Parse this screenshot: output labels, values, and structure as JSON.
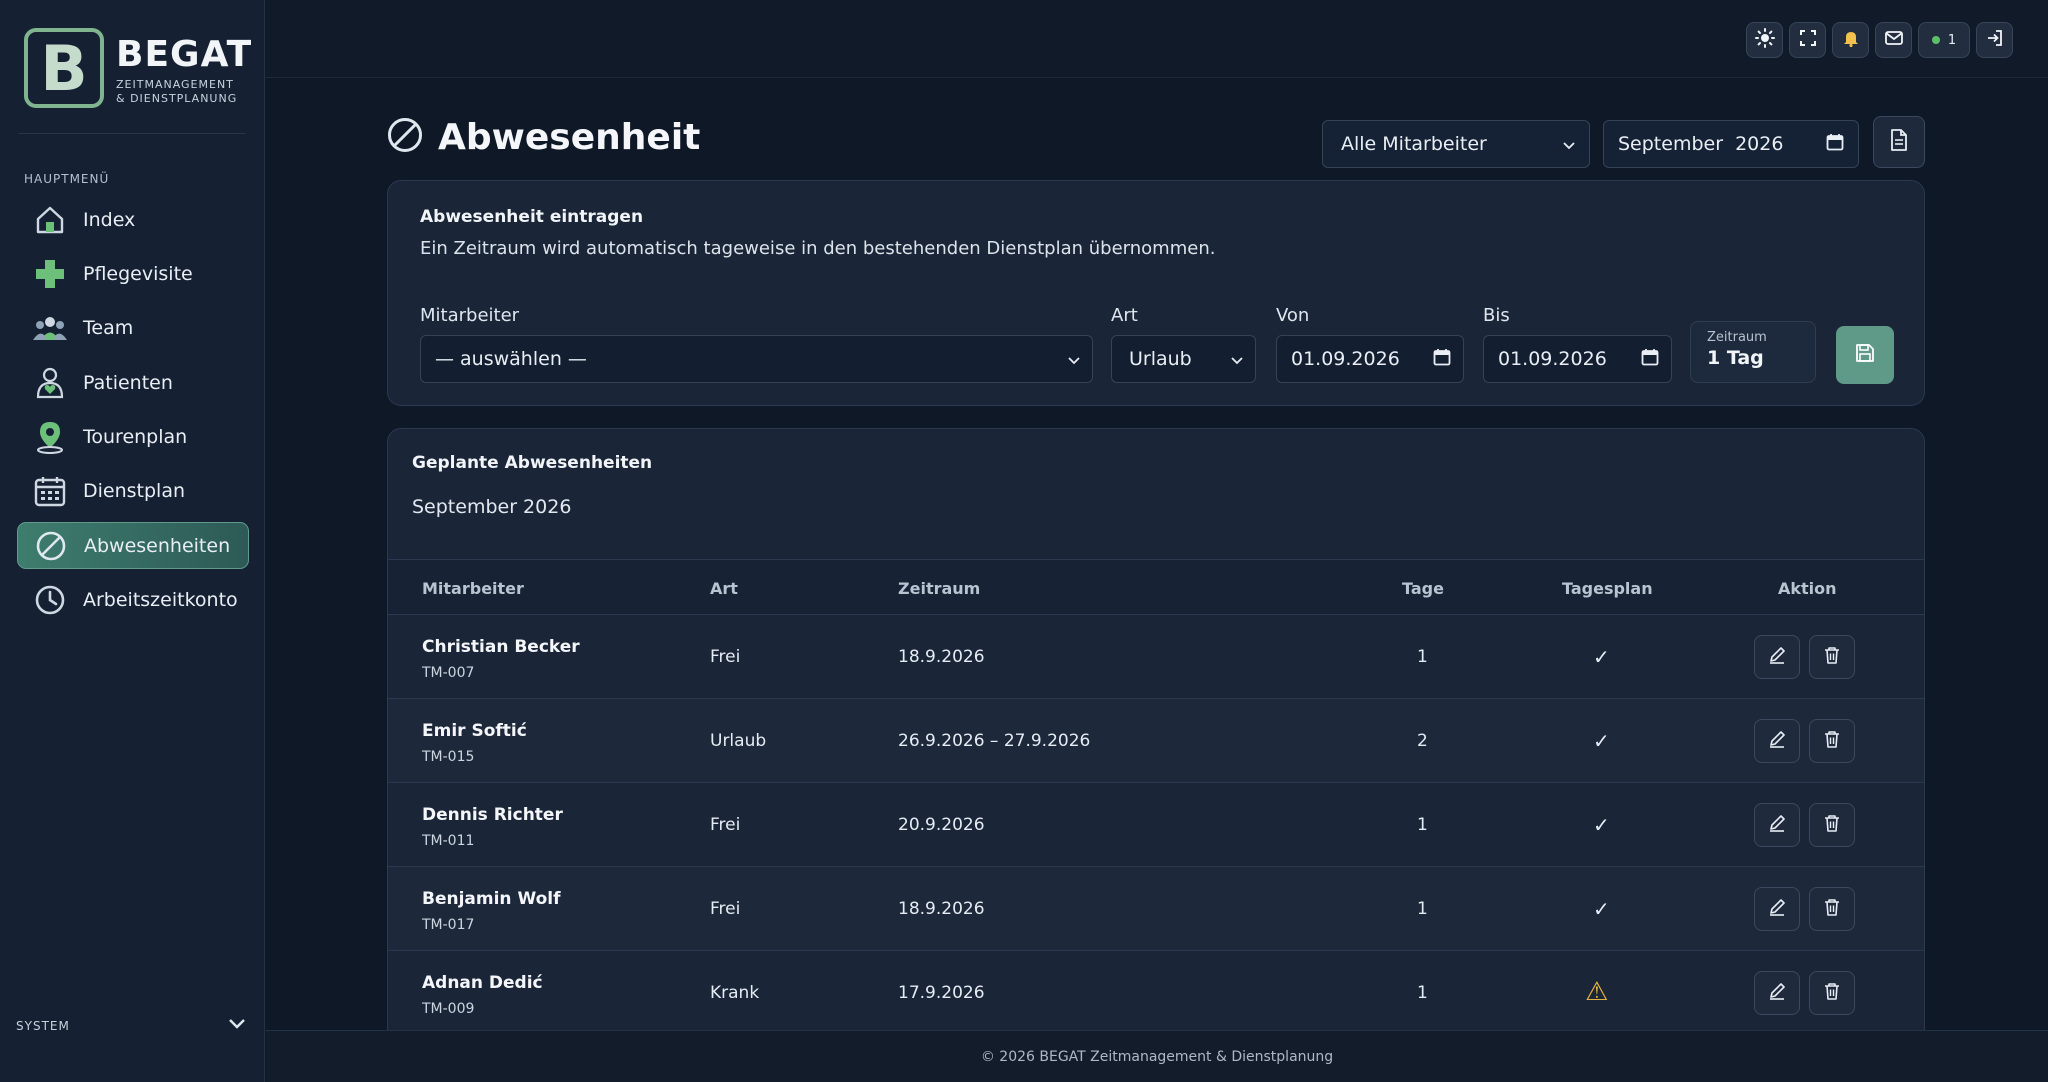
{
  "brand": {
    "letter": "B",
    "name": "BEGAT",
    "subtitle_line1": "ZEITMANAGEMENT",
    "subtitle_line2": "& DIENSTPLANUNG"
  },
  "sidebar": {
    "menu_heading": "HAUPTMENÜ",
    "items": [
      {
        "label": "Index",
        "icon": "home-icon"
      },
      {
        "label": "Pflegevisite",
        "icon": "medical-cross-icon"
      },
      {
        "label": "Team",
        "icon": "team-icon"
      },
      {
        "label": "Patienten",
        "icon": "patient-icon"
      },
      {
        "label": "Tourenplan",
        "icon": "map-pin-icon"
      },
      {
        "label": "Dienstplan",
        "icon": "calendar-icon"
      },
      {
        "label": "Abwesenheiten",
        "icon": "absence-icon",
        "active": true
      },
      {
        "label": "Arbeitszeitkonto",
        "icon": "clock-icon"
      }
    ],
    "system_label": "SYSTEM"
  },
  "topbar": {
    "online_count": "1",
    "icons": [
      "sun-icon",
      "fullscreen-icon",
      "bell-icon",
      "mail-icon",
      "online-status",
      "logout-icon"
    ]
  },
  "header": {
    "title": "Abwesenheit",
    "employee_filter": "Alle Mitarbeiter",
    "month_filter": "September  2026"
  },
  "entry_form": {
    "title": "Abwesenheit eintragen",
    "description": "Ein Zeitraum wird automatisch tageweise in den bestehenden Dienstplan übernommen.",
    "employee_label": "Mitarbeiter",
    "employee_value": "— auswählen —",
    "type_label": "Art",
    "type_value": "Urlaub",
    "from_label": "Von",
    "from_value": "01.09.2026",
    "to_label": "Bis",
    "to_value": "01.09.2026",
    "period_label": "Zeitraum",
    "period_value": "1 Tag"
  },
  "planned": {
    "title": "Geplante Abwesenheiten",
    "month": "September 2026",
    "columns": {
      "employee": "Mitarbeiter",
      "type": "Art",
      "period": "Zeitraum",
      "days": "Tage",
      "dayplan": "Tagesplan",
      "action": "Aktion"
    },
    "rows": [
      {
        "name": "Christian Becker",
        "id": "TM-007",
        "type": "Frei",
        "period": "18.9.2026",
        "days": "1",
        "dayplan": "✓"
      },
      {
        "name": "Emir Softić",
        "id": "TM-015",
        "type": "Urlaub",
        "period": "26.9.2026 – 27.9.2026",
        "days": "2",
        "dayplan": "✓"
      },
      {
        "name": "Dennis Richter",
        "id": "TM-011",
        "type": "Frei",
        "period": "20.9.2026",
        "days": "1",
        "dayplan": "✓"
      },
      {
        "name": "Benjamin Wolf",
        "id": "TM-017",
        "type": "Frei",
        "period": "18.9.2026",
        "days": "1",
        "dayplan": "✓"
      },
      {
        "name": "Adnan Dedić",
        "id": "TM-009",
        "type": "Krank",
        "period": "17.9.2026",
        "days": "1",
        "dayplan": "⚠"
      }
    ]
  },
  "footer": {
    "text": "© 2026 BEGAT Zeitmanagement & Dienstplanung"
  },
  "colors": {
    "accent": "#5e9a87",
    "warning": "#e3b341"
  }
}
